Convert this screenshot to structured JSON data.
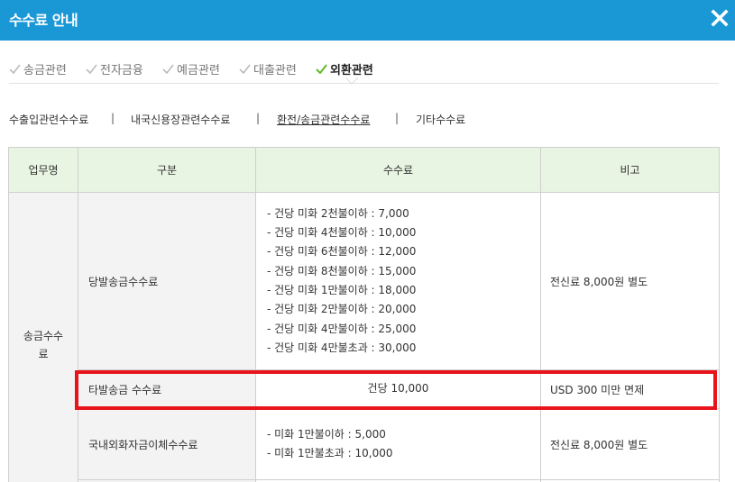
{
  "header": {
    "title": "수수료 안내"
  },
  "category_tabs": [
    {
      "label": "송금관련",
      "active": false
    },
    {
      "label": "전자금융",
      "active": false
    },
    {
      "label": "예금관련",
      "active": false
    },
    {
      "label": "대출관련",
      "active": false
    },
    {
      "label": "외환관련",
      "active": true
    }
  ],
  "sub_tabs": [
    {
      "label": "수출입관련수수료",
      "active": false
    },
    {
      "label": "내국신용장관련수수료",
      "active": false
    },
    {
      "label": "환전/송금관련수수료",
      "active": true
    },
    {
      "label": "기타수수료",
      "active": false
    }
  ],
  "sub_tab_separator": "|",
  "table": {
    "headers": [
      "업무명",
      "구분",
      "수수료",
      "비고"
    ],
    "business": "송금수수\n료",
    "rows": [
      {
        "type": "당발송금수수료",
        "fees": [
          "- 건당 미화 2천불이하 : 7,000",
          "- 건당 미화 4천불이하 : 10,000",
          "- 건당 미화 6천불이하 : 12,000",
          "- 건당 미화 8천불이하 : 15,000",
          "- 건당 미화 1만불이하 : 18,000",
          "- 건당 미화 2만불이하 : 20,000",
          "- 건당 미화 4만불이하 : 25,000",
          "- 건당 미화 4만불초과 : 30,000"
        ],
        "note": "전신료 8,000원 별도"
      },
      {
        "type": "타발송금 수수료",
        "fee": "건당 10,000",
        "note": "USD 300 미만 면제"
      },
      {
        "type": "국내외화자금이체수수료",
        "fees": [
          "- 미화 1만불이하 : 5,000",
          "- 미화 1만불초과 : 10,000"
        ],
        "note": "전신료 8,000원 별도"
      }
    ]
  },
  "colors": {
    "header_bg": "#1a98d5",
    "check_green": "#5dbb2a",
    "table_header_bg": "#e8f5e2",
    "highlight": "#e8141b"
  },
  "icons": {
    "close": "close-icon",
    "check": "check-icon"
  }
}
